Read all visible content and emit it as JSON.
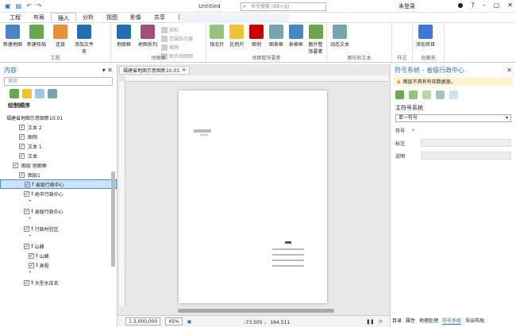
{
  "titlebar": {
    "title": "Untitled",
    "search_placeholder": "命令搜索 (Alt+Q)",
    "user": "未登录"
  },
  "tabs": [
    "工程",
    "布局",
    "插入",
    "分析",
    "视图",
    "影像",
    "共享",
    "要素图层",
    "标注",
    "数据"
  ],
  "ribbon": {
    "groups": [
      {
        "name": "工程",
        "buttons": [
          "新建地图",
          "新建布局",
          "连接",
          "添加文件夹"
        ]
      },
      {
        "name": "地图框",
        "buttons": [
          "地图框",
          "地图系列"
        ],
        "small": [
          "矩形",
          "范围指示器",
          "格网",
          "联合地图图"
        ]
      },
      {
        "name": "地图整饰要素",
        "buttons": [
          "指北针",
          "比例尺",
          "图例",
          "图表框",
          "表格框",
          "额外整饰要素"
        ]
      },
      {
        "name": "图形和文本",
        "buttons": [
          "动态文本"
        ]
      },
      {
        "name": "样式",
        "buttons": []
      },
      {
        "name": "收藏夹",
        "buttons": [
          "添加项目"
        ]
      }
    ]
  },
  "left": {
    "title": "内容",
    "search_placeholder": "搜索",
    "draw_order": "绘制顺序",
    "items": [
      "福建省地图示意图新10.01",
      "文本 2",
      "图例",
      "文本 1",
      "文本",
      "图层 地图框",
      "图层1",
      "省级行政中心",
      "地市行政中心",
      "县级行政中心",
      "行政村驻区",
      "山峰",
      "山峰",
      "高程",
      "大型水库名"
    ]
  },
  "center": {
    "doc_tab": "福建省地图示意图新10.01",
    "scale": "1:3,000,000",
    "zoom": "45%",
    "coords": "-73.505 ， 164.511"
  },
  "right": {
    "title": "符号系统 - 省级行政中心",
    "warning": "图层不具有有效数据源。",
    "main_symbology": "主符号系统",
    "symbology_value": "单一符号",
    "symbol_label": "符号",
    "label_label": "标注",
    "desc_label": "说明",
    "bottom_tabs": [
      "目录",
      "属性",
      "地理处理",
      "符号系统",
      "导出布局"
    ]
  }
}
